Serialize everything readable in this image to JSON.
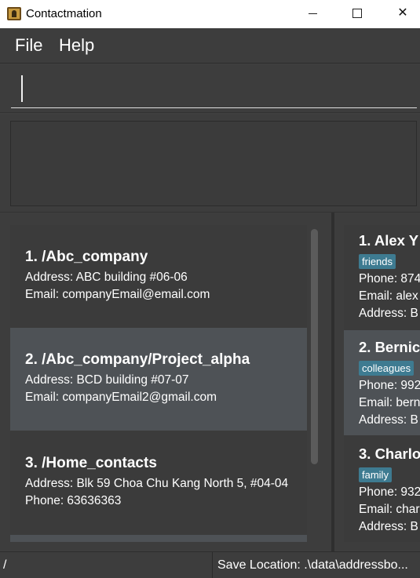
{
  "window": {
    "title": "Contactmation",
    "minimize_icon": "minimize-icon",
    "maximize_icon": "maximize-icon",
    "close_glyph": "✕"
  },
  "menu": {
    "file": "File",
    "help": "Help"
  },
  "command": {
    "value": "",
    "placeholder": ""
  },
  "result": {
    "text": ""
  },
  "groups": [
    {
      "title": "1.  /Abc_company",
      "line1": "Address: ABC building #06-06",
      "line2": "Email: companyEmail@email.com"
    },
    {
      "title": "2.  /Abc_company/Project_alpha",
      "line1": "Address: BCD building #07-07",
      "line2": "Email: companyEmail2@gmail.com"
    },
    {
      "title": "3.  /Home_contacts",
      "line1": "Address: Blk 59 Choa Chu Kang North 5, #04-04",
      "line2": "Phone: 63636363"
    }
  ],
  "persons": [
    {
      "title": "1.  Alex Y",
      "tag": "friends",
      "phone": "Phone: 874",
      "email": "Email: alex",
      "address": "Address: B"
    },
    {
      "title": "2.  Bernic",
      "tag": "colleagues",
      "phone": "Phone: 992",
      "email": "Email: bern",
      "address": "Address: B"
    },
    {
      "title": "3.  Charlo",
      "tag": "family",
      "phone": "Phone: 932",
      "email": "Email: char",
      "address": "Address: B"
    }
  ],
  "status": {
    "path": "/",
    "save_location": "Save Location: .\\data\\addressbo..."
  },
  "colors": {
    "accent_tag": "#3e7b91",
    "selected_row": "#4e5256",
    "background": "#3d3d3d"
  }
}
